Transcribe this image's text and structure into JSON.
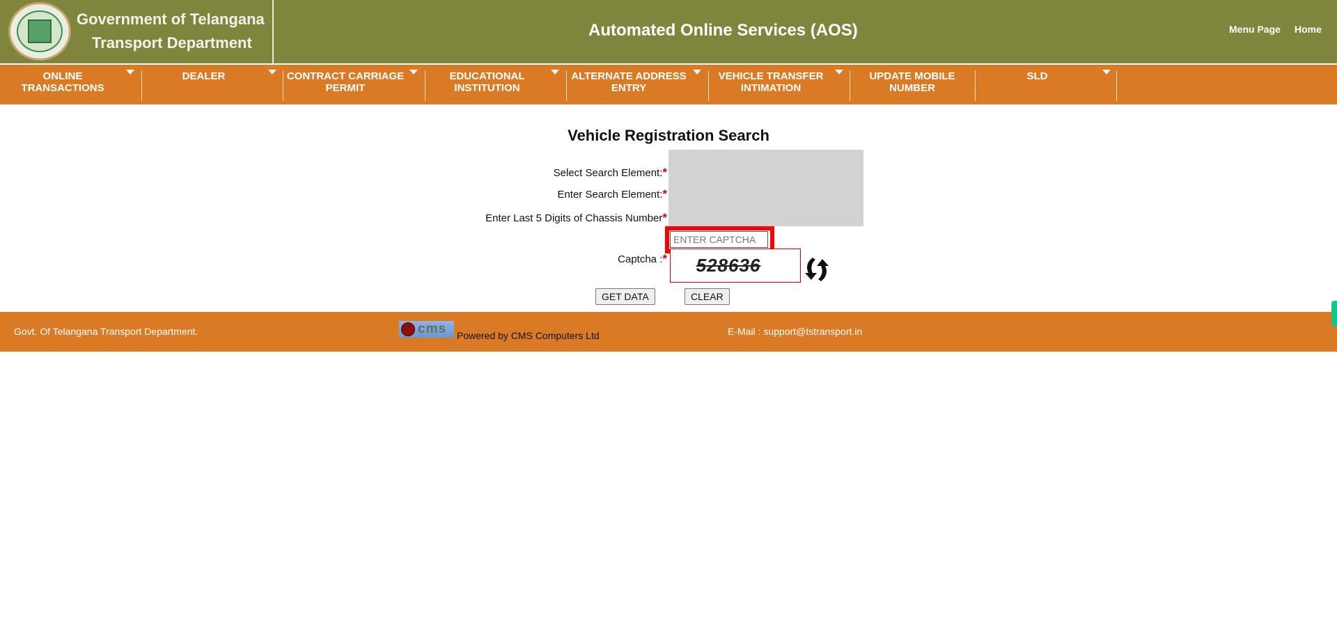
{
  "header": {
    "brand_line1": "Government of Telangana",
    "brand_line2": "Transport Department",
    "app_title": "Automated Online Services (AOS)",
    "links": [
      {
        "label": "Menu Page"
      },
      {
        "label": "Home"
      }
    ],
    "emblem_icon": "telangana-emblem"
  },
  "nav": {
    "items": [
      {
        "label": "ONLINE\nTRANSACTIONS",
        "has_dropdown": true
      },
      {
        "label": "DEALER",
        "has_dropdown": true
      },
      {
        "label": "CONTRACT CARRIAGE\nPERMIT",
        "has_dropdown": true
      },
      {
        "label": "EDUCATIONAL\nINSTITUTION",
        "has_dropdown": true
      },
      {
        "label": "ALTERNATE ADDRESS\nENTRY",
        "has_dropdown": true
      },
      {
        "label": "VEHICLE TRANSFER\nINTIMATION",
        "has_dropdown": true
      },
      {
        "label": "UPDATE MOBILE\nNUMBER",
        "has_dropdown": false
      },
      {
        "label": "SLD",
        "has_dropdown": true
      }
    ]
  },
  "form": {
    "title": "Vehicle Registration Search",
    "labels": {
      "select_search_element": "Select Search Element:",
      "enter_search_element": "Enter Search Element:",
      "chassis": "Enter Last 5 Digits of Chassis Number",
      "captcha": "Captcha :"
    },
    "required_mark": "*",
    "captcha_input": {
      "value": "",
      "placeholder": "ENTER CAPTCHA"
    },
    "captcha_code": "528636",
    "buttons": {
      "get_data": "GET DATA",
      "clear": "CLEAR"
    }
  },
  "footer": {
    "left": "Govt. Of Telangana Transport Department.",
    "cms_logo": "cms",
    "powered": "Powered by CMS Computers Ltd",
    "email": "E-Mail : support@tstransport.in"
  },
  "colors": {
    "header_bg": "#80853e",
    "nav_bg": "#db7a24",
    "footer_bg": "#db7a24",
    "required": "#e00000",
    "highlight": "#ff0000"
  }
}
